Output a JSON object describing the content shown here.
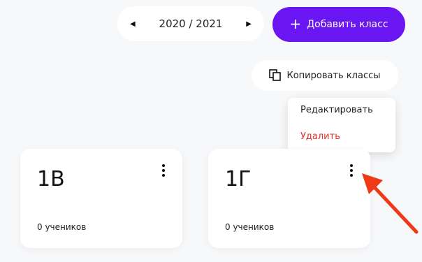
{
  "year_switch": {
    "prev_icon": "chevron-left-icon",
    "label": "2020 / 2021",
    "next_icon": "chevron-right-icon"
  },
  "add_button": {
    "icon": "plus-icon",
    "label": "Добавить класс"
  },
  "copy_button": {
    "icon": "copy-icon",
    "label": "Копировать классы"
  },
  "context_menu": {
    "items": [
      "Редактировать",
      "Удалить"
    ]
  },
  "classes": [
    {
      "name": "1В",
      "students": "0 учеников"
    },
    {
      "name": "1Г",
      "students": "0 учеников"
    }
  ],
  "colors": {
    "accent": "#6a16f3",
    "danger": "#e0312b",
    "annotation": "#f03a17"
  }
}
